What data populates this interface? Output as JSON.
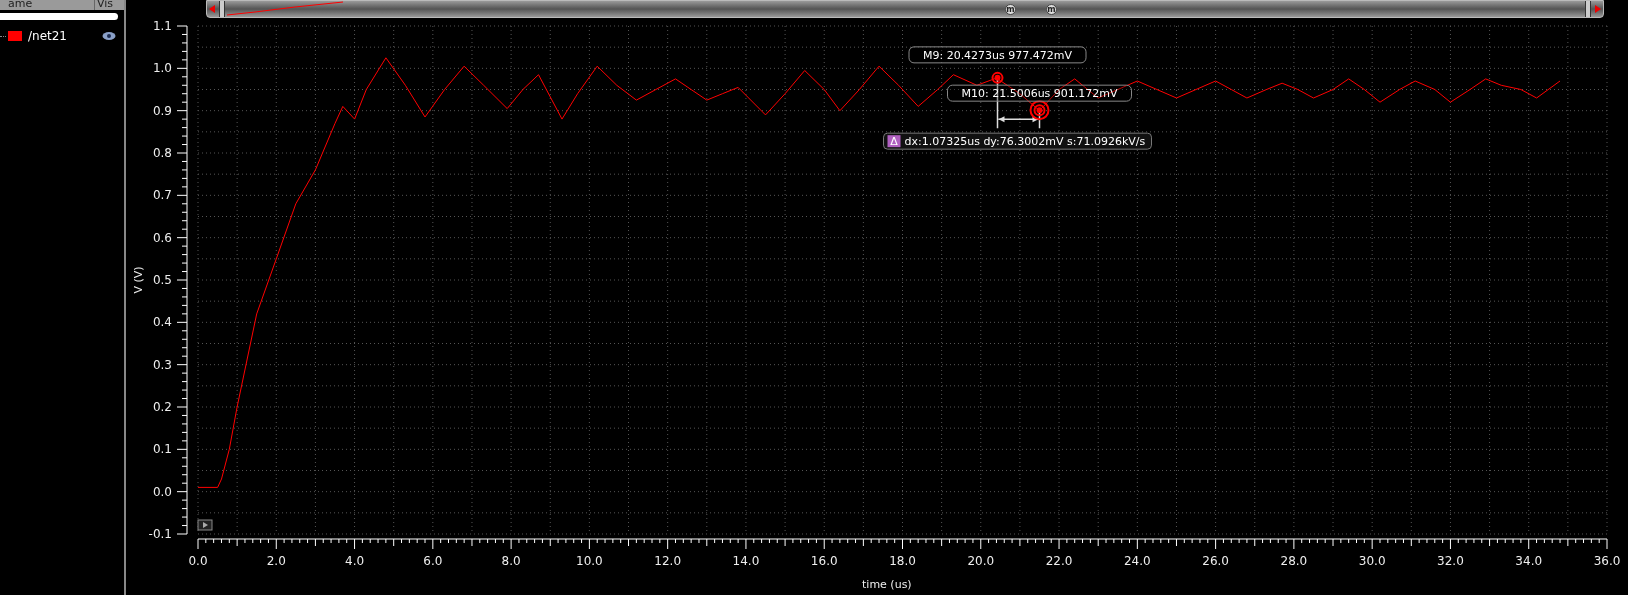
{
  "signal_panel": {
    "columns": [
      "ame",
      "Vis"
    ],
    "signals": [
      {
        "name": "/net21",
        "color": "#ff0000",
        "visible": true
      }
    ]
  },
  "overview": {
    "marker_labels": [
      "m",
      "m"
    ]
  },
  "plot": {
    "chart_data": {
      "type": "line",
      "xlabel": "time (us)",
      "ylabel": "V (V)",
      "x": [
        0,
        0.5,
        0.6,
        0.8,
        1.0,
        1.5,
        2.0,
        2.5,
        3.0,
        3.5,
        3.7,
        4.0,
        4.3,
        4.8,
        5.3,
        5.8,
        6.3,
        6.8,
        7.3,
        7.9,
        8.3,
        8.7,
        9.3,
        9.7,
        10.2,
        10.7,
        11.2,
        11.7,
        12.2,
        12.6,
        13.0,
        13.4,
        13.8,
        14.5,
        15.0,
        15.5,
        16.0,
        16.4,
        16.9,
        17.4,
        17.9,
        18.4,
        18.9,
        19.3,
        19.9,
        20.4,
        21.0,
        21.5,
        22.0,
        22.4,
        23.0,
        23.5,
        24.0,
        24.5,
        25.0,
        25.5,
        26.0,
        26.4,
        26.8,
        27.3,
        27.7,
        28.1,
        28.5,
        29.0,
        29.4,
        29.8,
        30.2,
        30.7,
        31.1,
        31.6,
        32.0,
        32.5,
        32.9,
        33.3,
        33.8,
        34.2,
        34.8
      ],
      "grid": true,
      "series": [
        {
          "color": "#ff0000",
          "values": [
            0.01,
            0.01,
            0.03,
            0.1,
            0.2,
            0.42,
            0.55,
            0.68,
            0.76,
            0.87,
            0.91,
            0.88,
            0.95,
            1.025,
            0.96,
            0.885,
            0.95,
            1.005,
            0.96,
            0.905,
            0.95,
            0.985,
            0.88,
            0.94,
            1.005,
            0.96,
            0.925,
            0.95,
            0.975,
            0.95,
            0.925,
            0.94,
            0.955,
            0.89,
            0.94,
            0.995,
            0.95,
            0.9,
            0.95,
            1.005,
            0.96,
            0.91,
            0.95,
            0.985,
            0.96,
            0.977,
            0.94,
            0.9,
            0.95,
            0.975,
            0.93,
            0.95,
            0.97,
            0.95,
            0.93,
            0.95,
            0.97,
            0.95,
            0.93,
            0.95,
            0.965,
            0.95,
            0.93,
            0.95,
            0.975,
            0.95,
            0.92,
            0.95,
            0.97,
            0.95,
            0.92,
            0.95,
            0.975,
            0.96,
            0.95,
            0.93,
            0.97
          ]
        }
      ],
      "xlim": [
        0,
        36
      ],
      "ylim": [
        -0.1,
        1.1
      ],
      "xticks": [
        {
          "value": 0,
          "label": "0.0"
        },
        {
          "value": 2,
          "label": "2.0"
        },
        {
          "value": 4,
          "label": "4.0"
        },
        {
          "value": 6,
          "label": "6.0"
        },
        {
          "value": 8,
          "label": "8.0"
        },
        {
          "value": 10,
          "label": "10.0"
        },
        {
          "value": 12,
          "label": "12.0"
        },
        {
          "value": 14,
          "label": "14.0"
        },
        {
          "value": 16,
          "label": "16.0"
        },
        {
          "value": 18,
          "label": "18.0"
        },
        {
          "value": 20,
          "label": "20.0"
        },
        {
          "value": 22,
          "label": "22.0"
        },
        {
          "value": 24,
          "label": "24.0"
        },
        {
          "value": 26,
          "label": "26.0"
        },
        {
          "value": 28,
          "label": "28.0"
        },
        {
          "value": 30,
          "label": "30.0"
        },
        {
          "value": 32,
          "label": "32.0"
        },
        {
          "value": 34,
          "label": "34.0"
        },
        {
          "value": 36,
          "label": "36.0"
        }
      ],
      "yticks": [
        {
          "value": 1.1,
          "label": "1.1"
        },
        {
          "value": 1.0,
          "label": "1.0"
        },
        {
          "value": 0.9,
          "label": "0.9"
        },
        {
          "value": 0.8,
          "label": "0.8"
        },
        {
          "value": 0.7,
          "label": "0.7"
        },
        {
          "value": 0.6,
          "label": "0.6"
        },
        {
          "value": 0.5,
          "label": "0.5"
        },
        {
          "value": 0.4,
          "label": "0.4"
        },
        {
          "value": 0.3,
          "label": "0.3"
        },
        {
          "value": 0.2,
          "label": "0.2"
        },
        {
          "value": 0.1,
          "label": "0.1"
        },
        {
          "value": 0,
          "label": "0.0"
        },
        {
          "value": -0.1,
          "label": "-0.1"
        }
      ],
      "annotations": [
        {
          "x": 20.4273,
          "y": 0.977472,
          "text": "M9: 20.4273us 977.472mV"
        },
        {
          "x": 21.5006,
          "y": 0.901172,
          "text": "M10: 21.5006us 901.172mV"
        }
      ]
    },
    "delta": {
      "icon": "Δ",
      "text": "dx:1.07325us dy:76.3002mV s:71.0926kV/s"
    }
  }
}
